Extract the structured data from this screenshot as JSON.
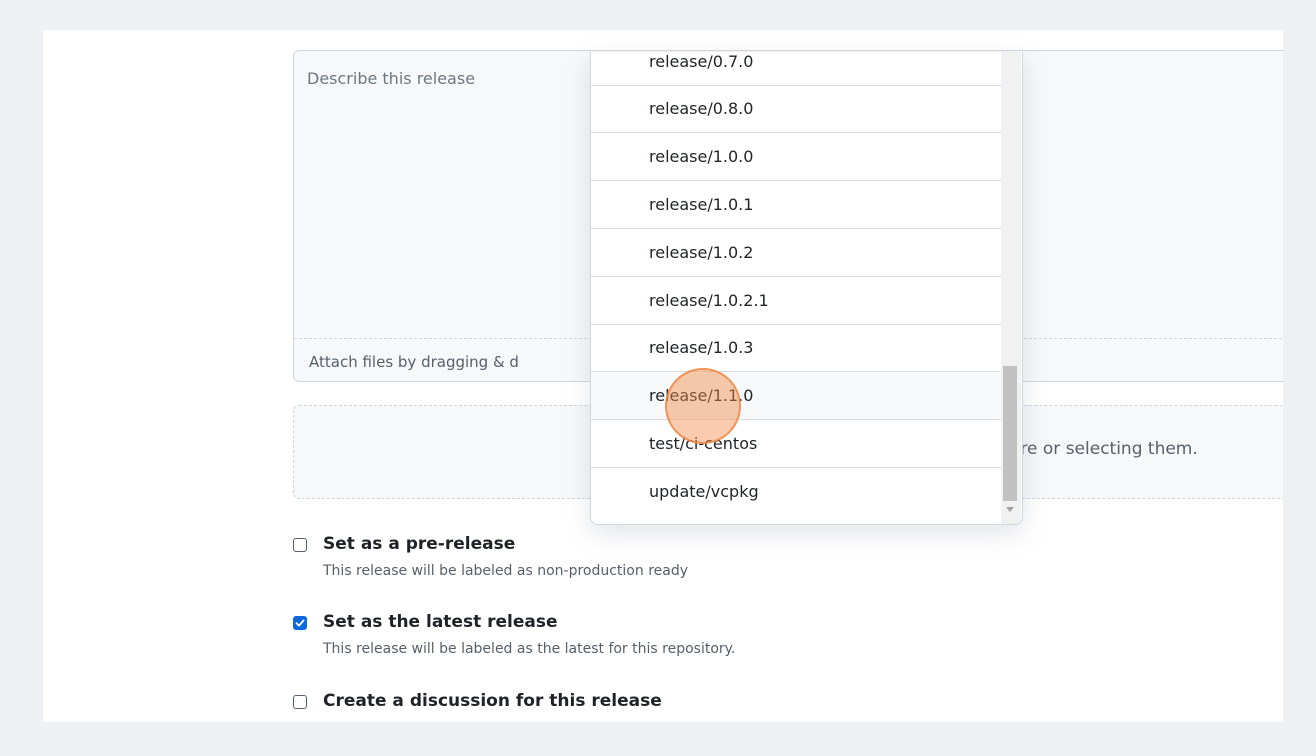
{
  "editor": {
    "placeholder": "Describe this release",
    "attach_text": "Attach files by dragging & d"
  },
  "dropzone": {
    "text": "hem here or selecting them."
  },
  "branch_dropdown": {
    "items": [
      "release/0.7.0",
      "release/0.8.0",
      "release/1.0.0",
      "release/1.0.1",
      "release/1.0.2",
      "release/1.0.2.1",
      "release/1.0.3",
      "release/1.1.0",
      "test/ci-centos",
      "update/vcpkg"
    ],
    "hovered": "release/1.1.0"
  },
  "options": {
    "prerelease": {
      "label": "Set as a pre-release",
      "description": "This release will be labeled as non-production ready",
      "checked": false
    },
    "latest": {
      "label": "Set as the latest release",
      "description": "This release will be labeled as the latest for this repository.",
      "checked": true
    },
    "discussion": {
      "label": "Create a discussion for this release",
      "checked": false
    }
  },
  "colors": {
    "accent": "#0969da",
    "cursor_highlight": "#f58c46"
  },
  "icons": {
    "checkmark": "check-icon"
  }
}
